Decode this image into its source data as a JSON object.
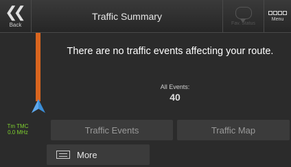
{
  "header": {
    "back_label": "Back",
    "title": "Traffic Summary",
    "favorites_label": "Fav. Status",
    "menu_label": "Menu"
  },
  "route": {
    "tmc_name": "Tm TMC",
    "tmc_freq": "0.0 MHz",
    "line_color": "#d9651f",
    "position_icon_color": "#3b8ed8"
  },
  "main": {
    "message": "There are no traffic events affecting your route.",
    "all_events_label": "All Events:",
    "all_events_count": "40"
  },
  "buttons": {
    "traffic_events": "Traffic Events",
    "traffic_map": "Traffic Map",
    "more": "More"
  },
  "icons": {
    "back": "double-chevron-left-icon",
    "favorites": "speech-bubble-icon",
    "menu": "four-squares-icon",
    "position": "navigation-arrow-icon",
    "more": "list-icon"
  }
}
